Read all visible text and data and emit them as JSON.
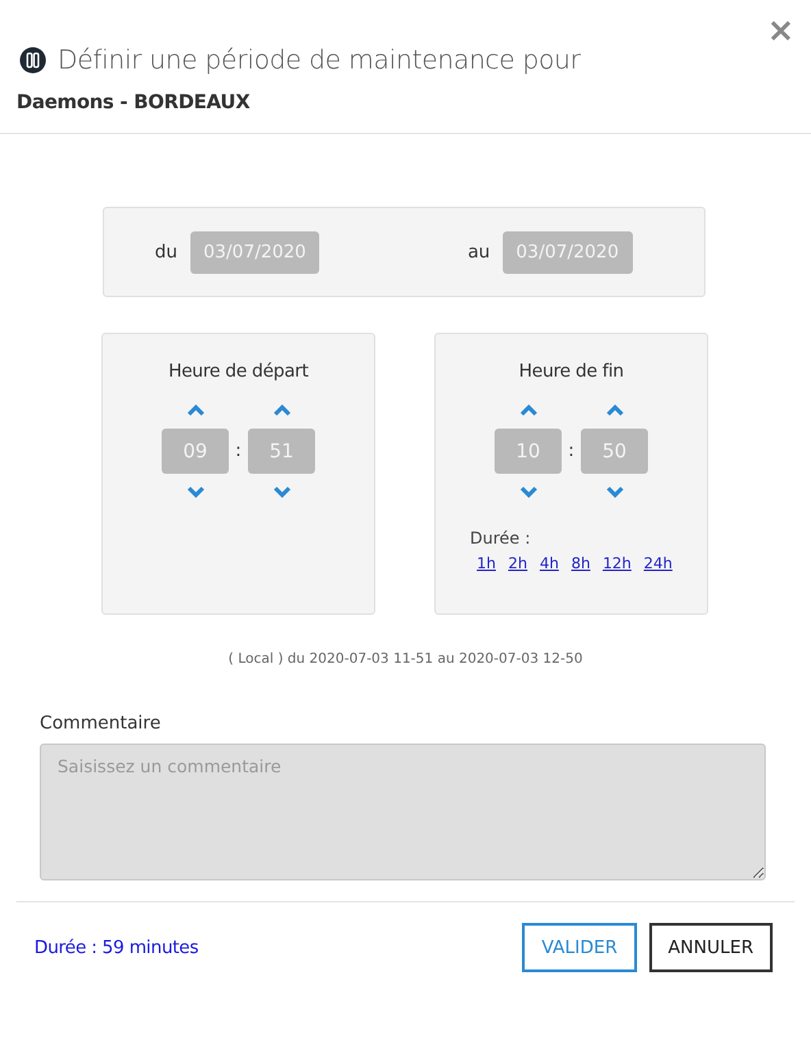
{
  "dialog": {
    "close": "×",
    "title": "Définir une période de maintenance pour",
    "subtitle": "Daemons - BORDEAUX"
  },
  "date_range": {
    "from_label": "du",
    "from": "03/07/2020",
    "to_label": "au",
    "to": "03/07/2020"
  },
  "time_panels": [
    {
      "title": "Heure de départ",
      "hours": "09",
      "separator": ":",
      "minutes": "51"
    },
    {
      "title": "Heure de fin",
      "hours": "10",
      "separator": ":",
      "minutes": "50",
      "duration_label": "Durée :",
      "presets": [
        "1h",
        "2h",
        "4h",
        "8h",
        "12h",
        "24h"
      ]
    }
  ],
  "summary": "( Local ) du 2020-07-03 11-51 au 2020-07-03 12-50",
  "comment": {
    "label": "Commentaire",
    "placeholder": "Saisissez un commentaire"
  },
  "footer": {
    "duration": "Durée : 59 minutes",
    "buttons": [
      {
        "label": "VALIDER",
        "kind": "primary"
      },
      {
        "label": "ANNULER",
        "kind": "secondary"
      }
    ]
  }
}
